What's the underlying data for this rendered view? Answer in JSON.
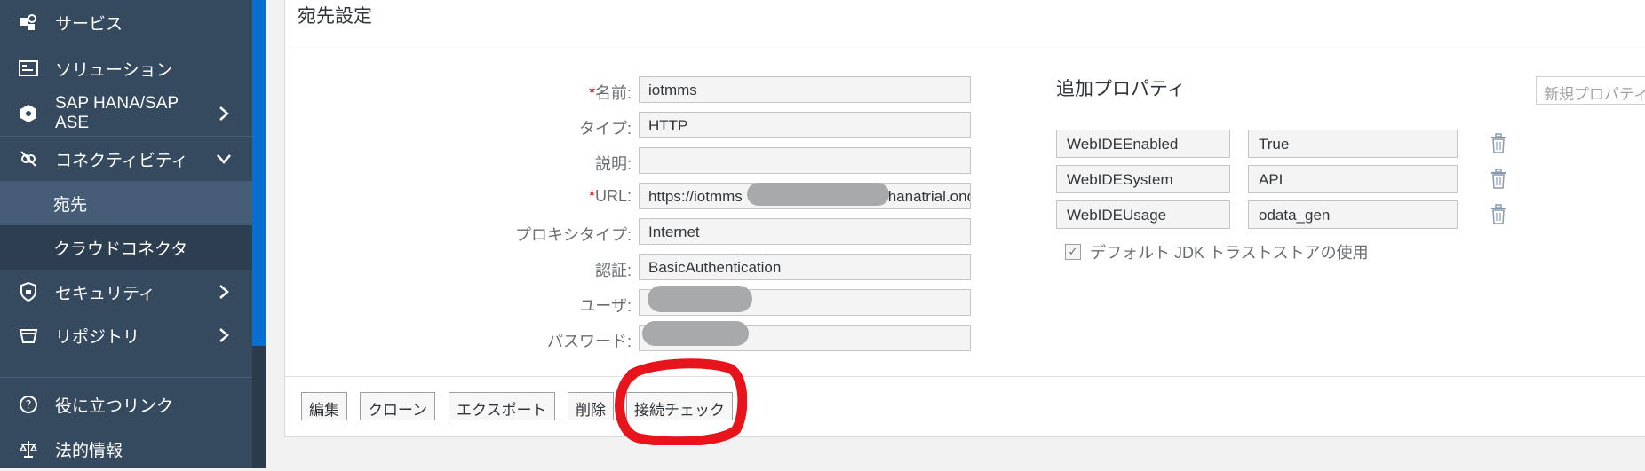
{
  "sidebar": {
    "items": [
      {
        "label": "サービス",
        "icon": "services-icon"
      },
      {
        "label": "ソリューション",
        "icon": "solutions-icon"
      },
      {
        "label": "SAP HANA/SAP ASE",
        "icon": "database-icon"
      },
      {
        "label": "コネクティビティ",
        "icon": "connectivity-icon"
      },
      {
        "label": "宛先"
      },
      {
        "label": "クラウドコネクタ"
      },
      {
        "label": "セキュリティ",
        "icon": "shield-icon"
      },
      {
        "label": "リポジトリ",
        "icon": "repository-icon"
      },
      {
        "label": "役に立つリンク",
        "icon": "help-icon"
      },
      {
        "label": "法的情報",
        "icon": "legal-icon"
      }
    ]
  },
  "panel": {
    "title": "宛先設定",
    "fields": [
      {
        "label": "名前:",
        "required": true,
        "value": "iotmms"
      },
      {
        "label": "タイプ:",
        "required": false,
        "value": "HTTP"
      },
      {
        "label": "説明:",
        "required": false,
        "value": ""
      },
      {
        "label": "URL:",
        "required": true,
        "value": "https://iotmms",
        "value_tail": "ial.hanatrial.onde"
      },
      {
        "label": "プロキシタイプ:",
        "required": false,
        "value": "Internet"
      },
      {
        "label": "認証:",
        "required": false,
        "value": "BasicAuthentication"
      },
      {
        "label": "ユーザ:",
        "required": false,
        "value": ""
      },
      {
        "label": "パスワード:",
        "required": false,
        "value": ""
      }
    ],
    "properties": {
      "title": "追加プロパティ",
      "new_button": "新規プロパティ",
      "rows": [
        {
          "key": "WebIDEEnabled",
          "value": "True"
        },
        {
          "key": "WebIDESystem",
          "value": "API"
        },
        {
          "key": "WebIDEUsage",
          "value": "odata_gen"
        }
      ],
      "checkbox_label": "デフォルト JDK トラストストアの使用",
      "checkbox_checked": true
    },
    "footer_buttons": [
      {
        "label": "編集"
      },
      {
        "label": "クローン"
      },
      {
        "label": "エクスポート"
      },
      {
        "label": "削除"
      },
      {
        "label": "接続チェック"
      }
    ]
  },
  "colors": {
    "sidebar_bg": "#354a5f",
    "sidebar_active": "#455d76",
    "accent_scrollbar": "#0a6ed1",
    "required_mark": "#bb0000",
    "highlight_annotation": "#e8141c"
  }
}
